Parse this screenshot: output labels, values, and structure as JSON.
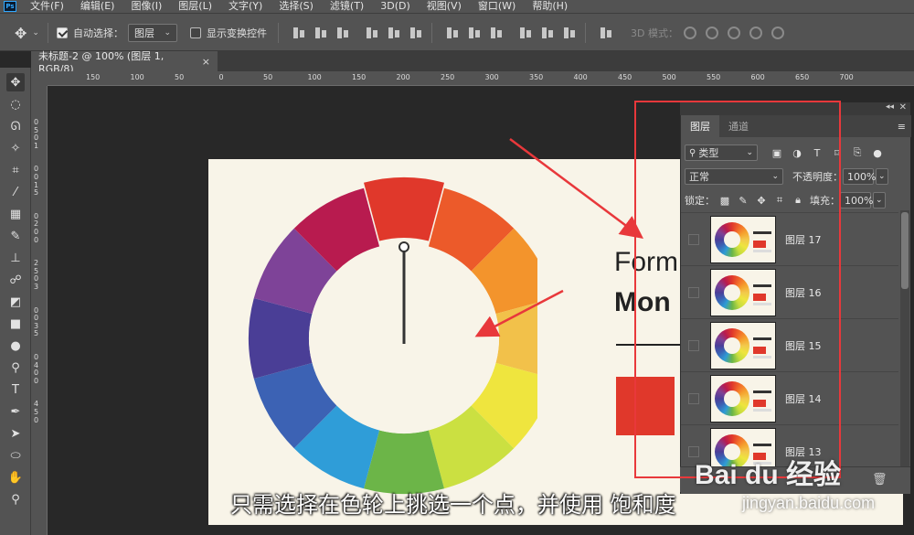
{
  "menubar": {
    "logo": "Ps",
    "items": [
      "文件(F)",
      "编辑(E)",
      "图像(I)",
      "图层(L)",
      "文字(Y)",
      "选择(S)",
      "滤镜(T)",
      "3D(D)",
      "视图(V)",
      "窗口(W)",
      "帮助(H)"
    ]
  },
  "options": {
    "auto_select_label": "自动选择：",
    "auto_select_value": "图层",
    "show_transform_label": "显示变换控件",
    "mode3d_label": "3D 模式："
  },
  "document_tab": {
    "title": "未标题-2 @ 100% (图层 1, RGB/8)",
    "close": "×"
  },
  "ruler": {
    "top_ticks": [
      "150",
      "100",
      "50",
      "0",
      "50",
      "100",
      "150",
      "200",
      "250",
      "300",
      "350",
      "400",
      "450",
      "500",
      "550",
      "600",
      "650",
      "700"
    ],
    "left_ticks": [
      "0",
      "5",
      "0",
      "1",
      "0",
      "0",
      "1",
      "5",
      "0",
      "2",
      "0",
      "0",
      "2",
      "5",
      "0",
      "3",
      "0",
      "0",
      "3",
      "5",
      "0",
      "4",
      "0",
      "0",
      "4",
      "5",
      "0"
    ]
  },
  "document": {
    "title_line1": "Form",
    "title_line2": "Mon",
    "swatch_color": "#e0382b"
  },
  "color_wheel": {
    "segments": [
      "#e0382b",
      "#ec5a2a",
      "#f3942c",
      "#f2c14a",
      "#efe53e",
      "#cbe041",
      "#6cb548",
      "#2f9dd8",
      "#3c62b4",
      "#4a3e96",
      "#7e4398",
      "#b81b4f"
    ]
  },
  "layers_panel": {
    "tab_layers": "图层",
    "tab_channels": "通道",
    "filter_kind": "类型",
    "blend_mode": "正常",
    "opacity_label": "不透明度：",
    "opacity_value": "100%",
    "lock_label": "锁定：",
    "fill_label": "填充：",
    "fill_value": "100%",
    "layers": [
      {
        "name": "图层 17"
      },
      {
        "name": "图层 16"
      },
      {
        "name": "图层 15"
      },
      {
        "name": "图层 14"
      },
      {
        "name": "图层 13"
      }
    ]
  },
  "subtitle": "只需选择在色轮上挑选一个点，并使用 饱和度",
  "watermark": {
    "brand": "Bai du 经验",
    "url": "jingyan.baidu.com"
  },
  "colors": {
    "accent_red": "#e8383b",
    "panel_bg": "#535353",
    "canvas_bg": "#282828"
  }
}
